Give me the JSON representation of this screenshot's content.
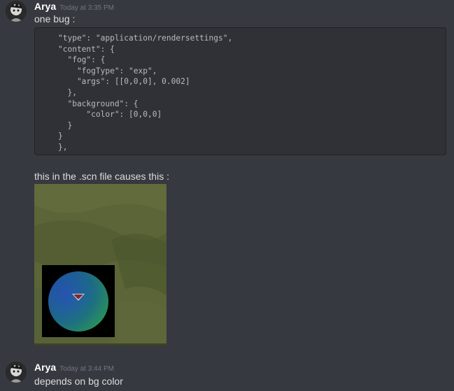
{
  "messages": [
    {
      "author": "Arya",
      "timestamp": "Today at 3:35 PM",
      "text1": "one bug :",
      "code": "\"type\": \"application/rendersettings\",\n\"content\": {\n  \"fog\": {\n    \"fogType\": \"exp\",\n    \"args\": [[0,0,0], 0.002]\n  },\n  \"background\": {\n      \"color\": [0,0,0]\n  }\n}\n},",
      "text2": "this in the .scn file causes this :",
      "attachment": {
        "icon": "render-screenshot",
        "colors": {
          "terrain": "#5a6436",
          "shade": "#4a542c",
          "inset_bg": "#000000",
          "sphere_blue": "#1f3fa0",
          "sphere_green": "#2fa048"
        }
      }
    },
    {
      "author": "Arya",
      "timestamp": "Today at 3:44 PM",
      "text1": "depends on bg color"
    }
  ],
  "theme": {
    "background": "#36393f",
    "code_background": "#2f3136",
    "username_color": "#ffffff",
    "timestamp_color": "#72767d",
    "text_color": "#dcddde"
  }
}
